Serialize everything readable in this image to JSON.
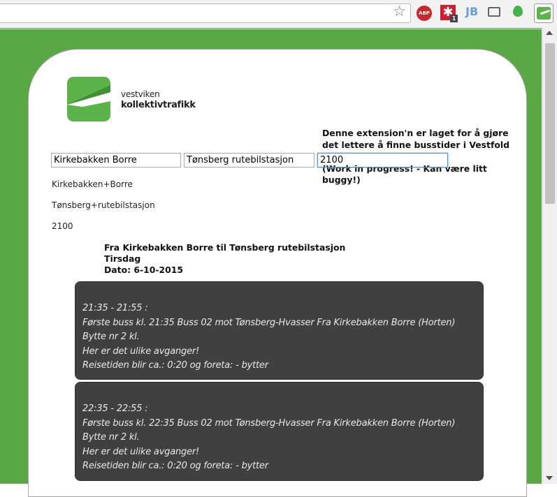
{
  "browser": {
    "extensions": [
      {
        "name": "star-icon",
        "label": "☆"
      },
      {
        "name": "adblock-plus-icon",
        "label": "ABP"
      },
      {
        "name": "lastpass-icon",
        "label": "✱",
        "badge": "1"
      },
      {
        "name": "jetbrains-icon",
        "label": "JB"
      },
      {
        "name": "cast-icon"
      },
      {
        "name": "location-pin-icon"
      },
      {
        "name": "vestviken-extension-icon"
      }
    ]
  },
  "logo": {
    "line1": "vestviken",
    "line2": "kollektivtrafikk",
    "color": "#5bb34a"
  },
  "notice": {
    "text": "Denne extension'n er laget for å gjøre det lettere å finne busstider i Vestfold",
    "wip": "(Work in progress! - Kan være litt buggy!)"
  },
  "form": {
    "from_value": "Kirkebakken Borre",
    "to_value": "Tønsberg rutebilstasjon",
    "time_value": "2100"
  },
  "echo": {
    "from": "Kirkebakken+Borre",
    "to": "Tønsberg+rutebilstasjon",
    "time": "2100"
  },
  "result": {
    "route": "Fra Kirkebakken Borre til Tønsberg rutebilstasjon",
    "weekday": "Tirsdag",
    "date": "Dato: 6-10-2015"
  },
  "departures": [
    {
      "time": "21:35 - 21:55 :",
      "line": "Første buss kl. 21:35 Buss 02 mot Tønsberg-Hvasser Fra Kirkebakken Borre (Horten)",
      "change": "Bytte nr 2 kl.",
      "note": "Her er det ulike avganger!",
      "duration": "Reisetiden blir ca.: 0:20 og foreta: - bytter"
    },
    {
      "time": "22:35 - 22:55 :",
      "line": "Første buss kl. 22:35 Buss 02 mot Tønsberg-Hvasser Fra Kirkebakken Borre (Horten)",
      "change": "Bytte nr 2 kl.",
      "note": "Her er det ulike avganger!",
      "duration": "Reisetiden blir ca.: 0:20 og foreta: - bytter"
    }
  ],
  "colors": {
    "frame_green": "#5aa845",
    "card_dark": "#404040",
    "focus_blue": "#4a90d9"
  }
}
